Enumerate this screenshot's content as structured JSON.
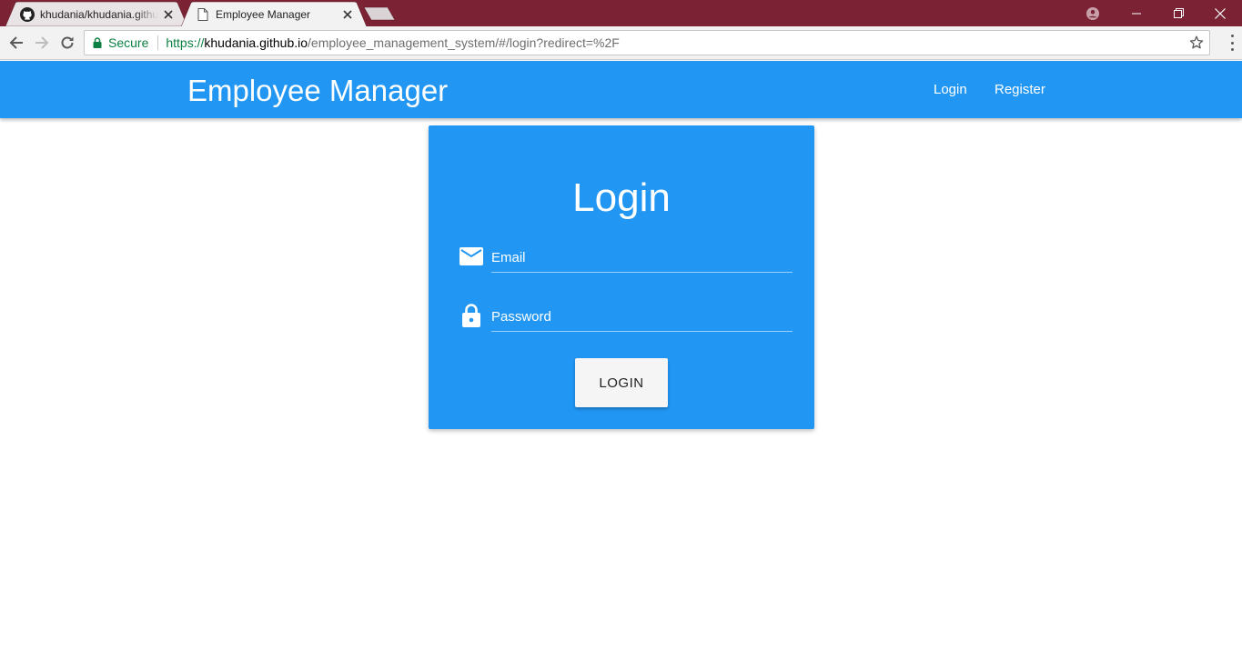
{
  "browser": {
    "tabs": [
      {
        "title": "khudania/khudania.githu",
        "favicon": "github-icon",
        "active": false
      },
      {
        "title": "Employee Manager",
        "favicon": "document-icon",
        "active": true
      }
    ],
    "omnibox": {
      "secure_label": "Secure",
      "url_scheme": "https://",
      "url_host": "khudania.github.io",
      "url_path": "/employee_management_system/#/login?redirect=%2F"
    },
    "colors": {
      "titlebar": "#7b2335",
      "toolbar": "#f2f2f2",
      "secure": "#0b8043"
    }
  },
  "navbar": {
    "brand": "Employee Manager",
    "links": [
      {
        "label": "Login"
      },
      {
        "label": "Register"
      }
    ],
    "color": "#2196f3"
  },
  "login_card": {
    "title": "Login",
    "email_field": {
      "placeholder": "Email",
      "value": "",
      "icon": "envelope-icon"
    },
    "password_field": {
      "placeholder": "Password",
      "value": "",
      "icon": "lock-icon"
    },
    "submit_label": "LOGIN",
    "color": "#2196f3"
  }
}
